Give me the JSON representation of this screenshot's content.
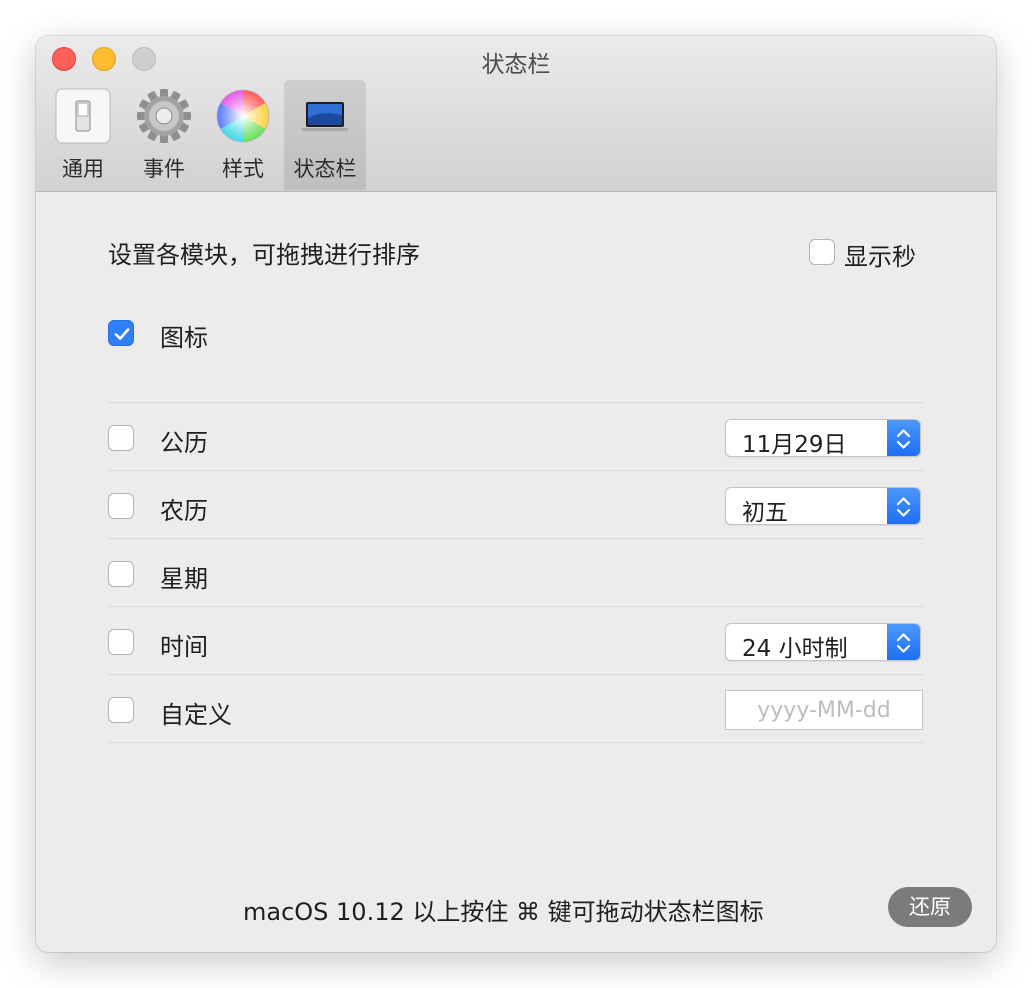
{
  "window": {
    "title": "状态栏"
  },
  "toolbar": {
    "items": [
      {
        "label": "通用",
        "icon": "switch-icon"
      },
      {
        "label": "事件",
        "icon": "gear-icon"
      },
      {
        "label": "样式",
        "icon": "color-wheel-icon"
      },
      {
        "label": "状态栏",
        "icon": "laptop-icon",
        "active": true
      }
    ]
  },
  "content": {
    "heading": "设置各模块，可拖拽进行排序",
    "show_seconds": {
      "label": "显示秒",
      "checked": false
    },
    "rows": [
      {
        "label": "图标",
        "checked": true
      },
      {
        "label": "公历",
        "checked": false,
        "popup": "11月29日"
      },
      {
        "label": "农历",
        "checked": false,
        "popup": "初五"
      },
      {
        "label": "星期",
        "checked": false
      },
      {
        "label": "时间",
        "checked": false,
        "popup": "24 小时制"
      },
      {
        "label": "自定义",
        "checked": false,
        "placeholder": "yyyy-MM-dd"
      }
    ]
  },
  "footer": {
    "note": "macOS 10.12 以上按住 ⌘ 键可拖动状态栏图标",
    "restore_label": "还原"
  },
  "colors": {
    "accent": "#2f7ff8",
    "close": "#fe5f57",
    "minimize": "#febc2e"
  }
}
